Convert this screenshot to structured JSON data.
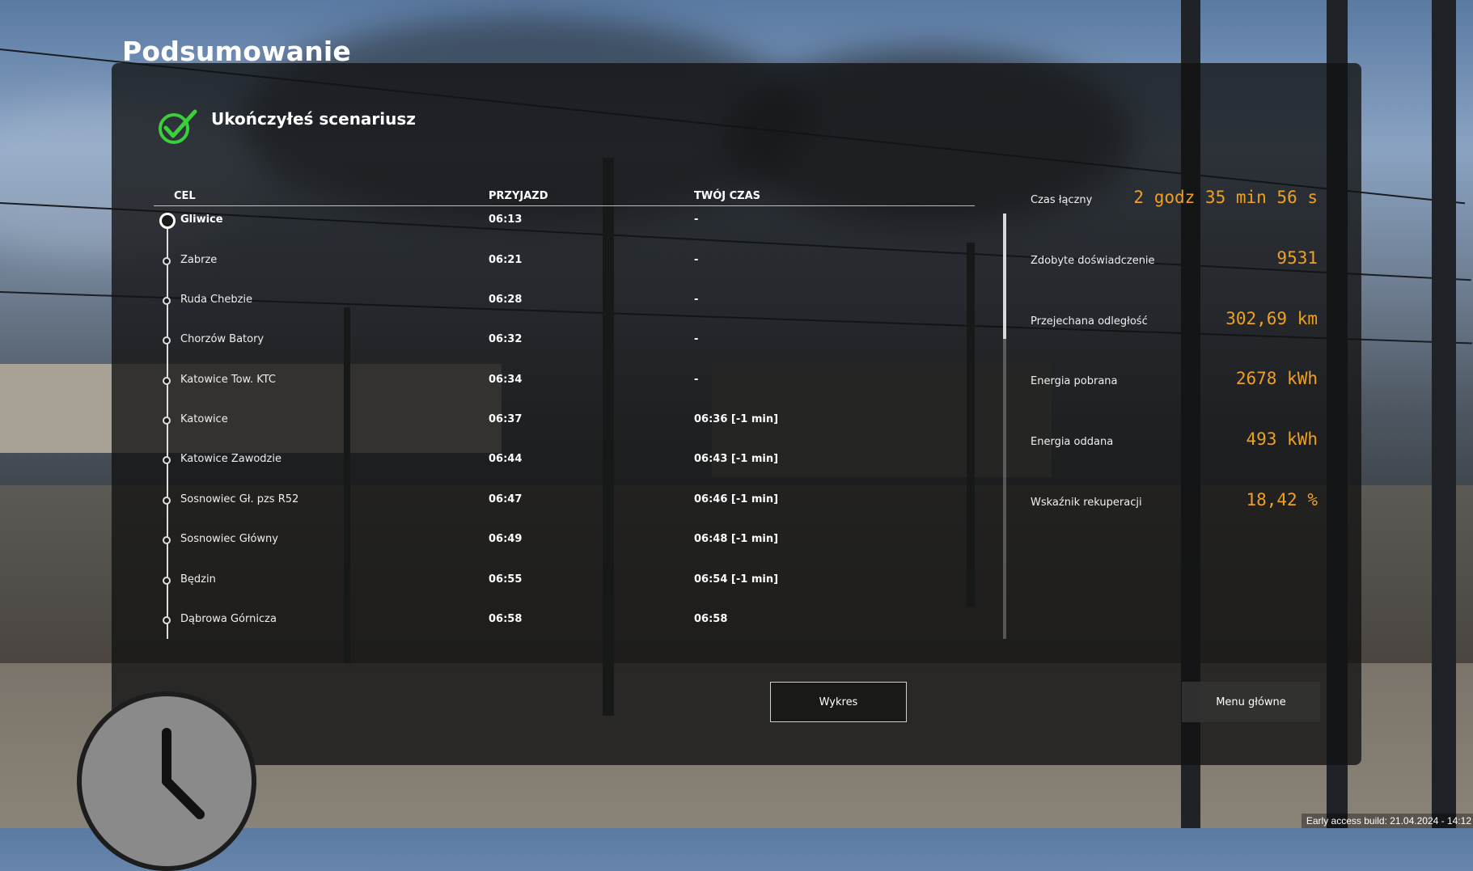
{
  "page_title": "Podsumowanie",
  "completion": {
    "icon": "check-icon",
    "message": "Ukończyłeś scenariusz",
    "icon_color": "#3ccf3c"
  },
  "table": {
    "headers": {
      "destination": "CEL",
      "arrival": "PRZYJAZD",
      "your_time": "TWÓJ CZAS"
    },
    "rows": [
      {
        "name": "Gliwice",
        "arrival": "06:13",
        "your_time": "-"
      },
      {
        "name": "Zabrze",
        "arrival": "06:21",
        "your_time": "-"
      },
      {
        "name": "Ruda Chebzie",
        "arrival": "06:28",
        "your_time": "-"
      },
      {
        "name": "Chorzów Batory",
        "arrival": "06:32",
        "your_time": "-"
      },
      {
        "name": "Katowice Tow. KTC",
        "arrival": "06:34",
        "your_time": "-"
      },
      {
        "name": "Katowice",
        "arrival": "06:37",
        "your_time": "06:36 [-1 min]"
      },
      {
        "name": "Katowice Zawodzie",
        "arrival": "06:44",
        "your_time": "06:43 [-1 min]"
      },
      {
        "name": "Sosnowiec Gł. pzs R52",
        "arrival": "06:47",
        "your_time": "06:46 [-1 min]"
      },
      {
        "name": "Sosnowiec Główny",
        "arrival": "06:49",
        "your_time": "06:48 [-1 min]"
      },
      {
        "name": "Będzin",
        "arrival": "06:55",
        "your_time": "06:54 [-1 min]"
      },
      {
        "name": "Dąbrowa Górnicza",
        "arrival": "06:58",
        "your_time": "06:58"
      }
    ]
  },
  "stats": [
    {
      "label": "Czas łączny",
      "value": "2 godz 35 min 56 s"
    },
    {
      "label": "Zdobyte doświadczenie",
      "value": "9531"
    },
    {
      "label": "Przejechana odległość",
      "value": "302,69 km"
    },
    {
      "label": "Energia pobrana",
      "value": "2678 kWh"
    },
    {
      "label": "Energia oddana",
      "value": "493 kWh"
    },
    {
      "label": "Wskaźnik rekuperacji",
      "value": "18,42 %"
    }
  ],
  "buttons": {
    "chart": "Wykres",
    "main_menu": "Menu główne"
  },
  "build_info": "Early access build: 21.04.2024 - 14:12",
  "colors": {
    "accent_value": "#f0a020",
    "panel_bg": "#121212"
  }
}
